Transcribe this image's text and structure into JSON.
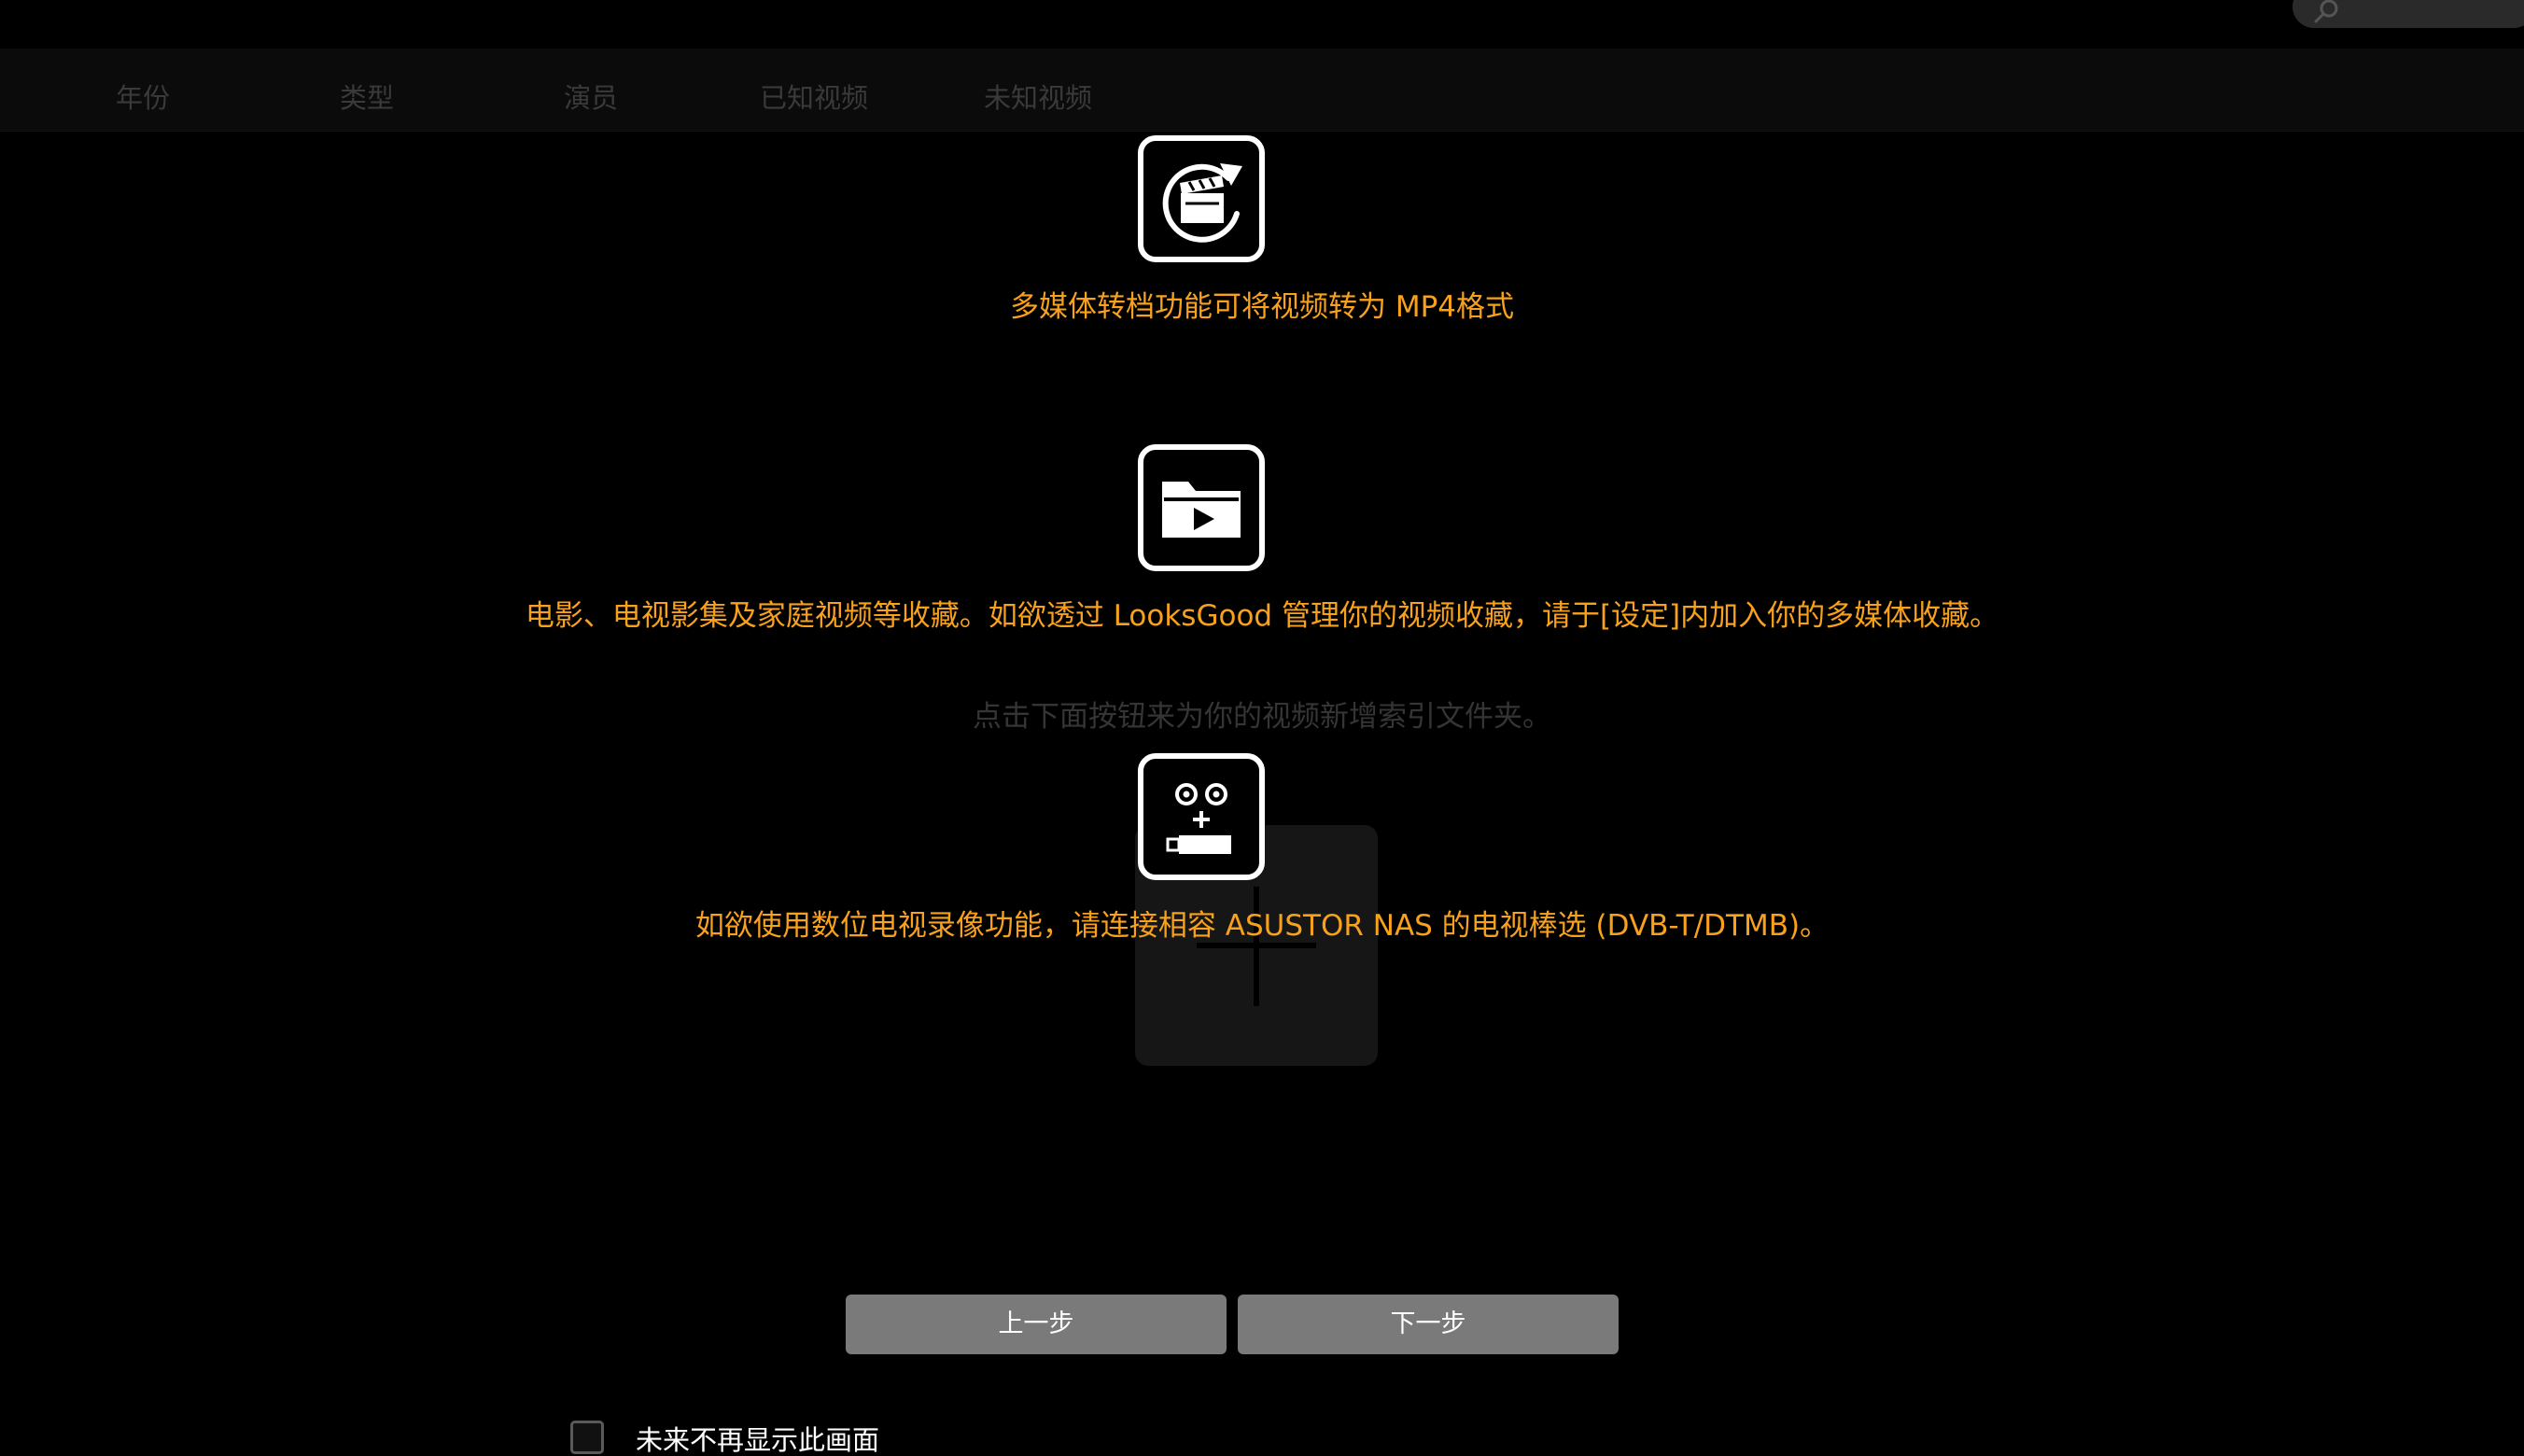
{
  "search": {
    "icon": "search-icon"
  },
  "tabs": [
    {
      "label": "年份"
    },
    {
      "label": "类型"
    },
    {
      "label": "演员"
    },
    {
      "label": "已知视频"
    },
    {
      "label": "未知视频"
    }
  ],
  "background": {
    "hint": "点击下面按钮来为你的视频新增索引文件夹。",
    "add_icon": "plus-icon"
  },
  "features": [
    {
      "icon": "video-convert-icon",
      "text": "多媒体转档功能可将视频转为 MP4格式"
    },
    {
      "icon": "video-folder-icon",
      "text": "电影、电视影集及家庭视频等收藏。如欲透过 LooksGood 管理你的视频收藏，请于[设定]内加入你的多媒体收藏。"
    },
    {
      "icon": "tv-dongle-icon",
      "text": "如欲使用数位电视录像功能，请连接相容 ASUSTOR NAS 的电视棒选 (DVB-T/DTMB)。"
    }
  ],
  "buttons": {
    "prev": "上一步",
    "next": "下一步"
  },
  "dont_show": {
    "label": "未来不再显示此画面",
    "checked": false
  },
  "colors": {
    "accent_text": "#f7a11d",
    "button_bg": "#7a7a7a",
    "background": "#000000"
  }
}
